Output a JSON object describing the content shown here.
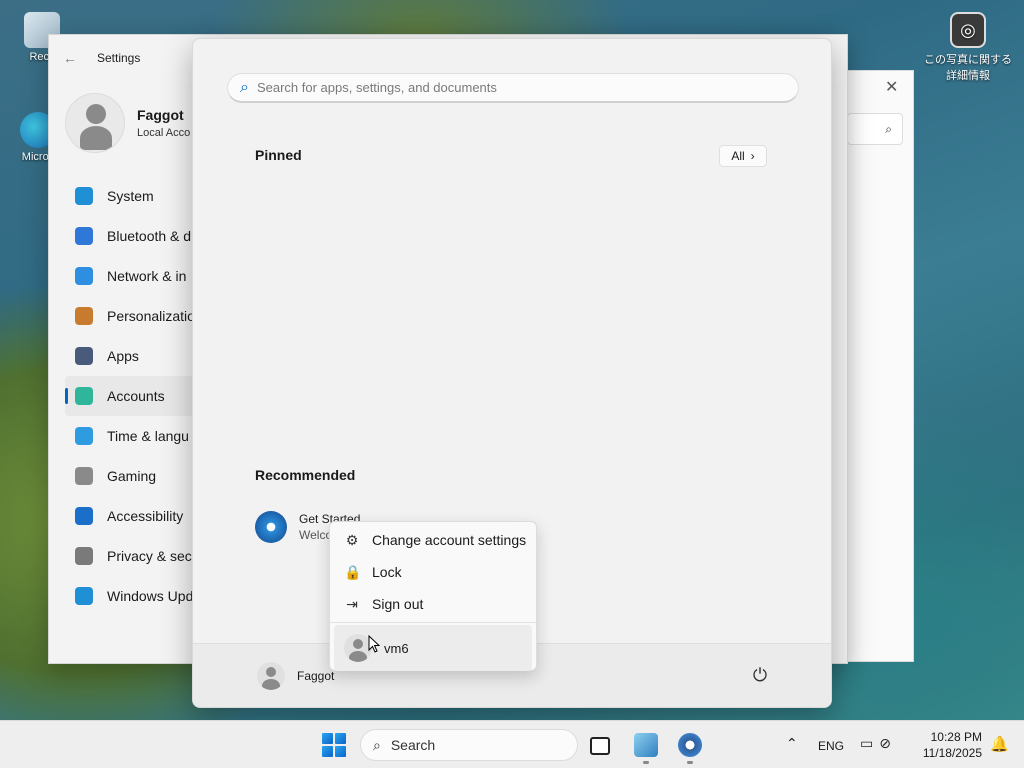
{
  "desktop": {
    "recycle_label": "Recy",
    "edge_label": "Micros",
    "photo_label": "この写真に関する詳細情報"
  },
  "settings": {
    "title": "Settings",
    "back_glyph": "←",
    "user_name": "Faggot",
    "user_sub": "Local Acco",
    "nav": [
      {
        "label": "System",
        "color": "#1f8fd6"
      },
      {
        "label": "Bluetooth & d",
        "color": "#2f78d8"
      },
      {
        "label": "Network & in",
        "color": "#2e8fe0"
      },
      {
        "label": "Personalizatio",
        "color": "#c87b2f"
      },
      {
        "label": "Apps",
        "color": "#4a5a7a"
      },
      {
        "label": "Accounts",
        "color": "#2fb59a"
      },
      {
        "label": "Time & langu",
        "color": "#2f9be0"
      },
      {
        "label": "Gaming",
        "color": "#8a8a8a"
      },
      {
        "label": "Accessibility",
        "color": "#1b6fc9"
      },
      {
        "label": "Privacy & secu",
        "color": "#7a7a7a"
      },
      {
        "label": "Windows Upd",
        "color": "#1f8fd6"
      }
    ]
  },
  "start_menu": {
    "search_placeholder": "Search for apps, settings, and documents",
    "pinned_title": "Pinned",
    "all_label": "All",
    "all_chevron": "›",
    "recommended_title": "Recommended",
    "rec_title": "Get Started",
    "rec_sub": "Welco",
    "footer_user": "Faggot",
    "power_glyph": "⏻"
  },
  "context_menu": {
    "items": [
      {
        "label": "Change account settings",
        "icon": "⚙"
      },
      {
        "label": "Lock",
        "icon": "🔒"
      },
      {
        "label": "Sign out",
        "icon": "⇥"
      }
    ],
    "other_user": "vm6"
  },
  "taskbar": {
    "search_label": "Search",
    "chevron": "⌃",
    "language": "ENG",
    "tray_icons": "▭⊘",
    "time": "10:28 PM",
    "date": "11/18/2025",
    "notification_glyph": "🔔"
  }
}
